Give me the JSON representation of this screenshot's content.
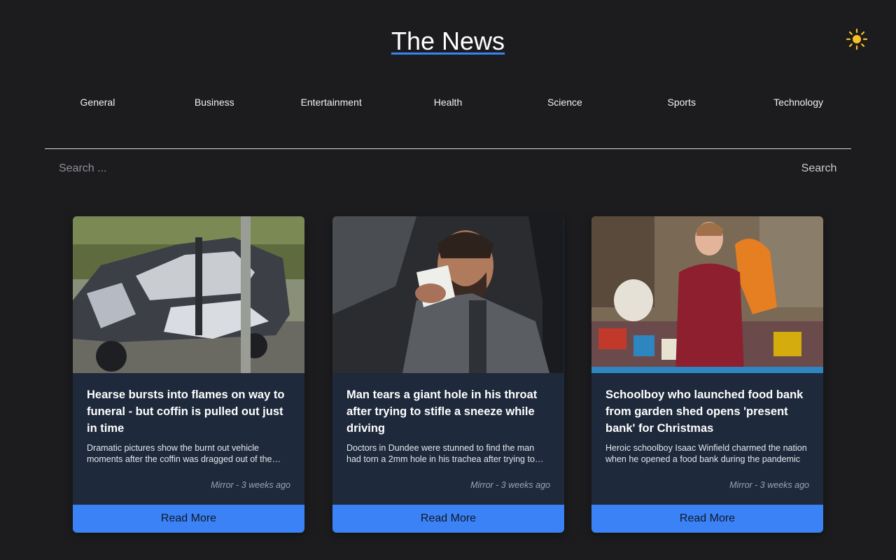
{
  "header": {
    "title": "The News",
    "theme_toggle_icon": "sun-icon",
    "accent_color": "#3b82f6",
    "sun_color": "#fbbf24"
  },
  "nav": {
    "categories": [
      "General",
      "Business",
      "Entertainment",
      "Health",
      "Science",
      "Sports",
      "Technology"
    ]
  },
  "search": {
    "placeholder": "Search ...",
    "button_label": "Search"
  },
  "articles": [
    {
      "title": "Hearse bursts into flames on way to funeral - but coffin is pulled out just in time",
      "description": "Dramatic pictures show the burnt out vehicle moments after the coffin was dragged out of the hearse",
      "source": "Mirror",
      "time": "3 weeks ago",
      "meta": "Mirror - 3 weeks ago",
      "read_more": "Read More",
      "image_icon": "burnt-car-photo"
    },
    {
      "title": "Man tears a giant hole in his throat after trying to stifle a sneeze while driving",
      "description": "Doctors in Dundee were stunned to find the man had torn a 2mm hole in his trachea after trying to hold in a sneeze",
      "source": "Mirror",
      "time": "3 weeks ago",
      "meta": "Mirror - 3 weeks ago",
      "read_more": "Read More",
      "image_icon": "sneezing-driver-photo"
    },
    {
      "title": "Schoolboy who launched food bank from garden shed opens 'present bank' for Christmas",
      "description": "Heroic schoolboy Isaac Winfield charmed the nation when he opened a food bank during the pandemic",
      "source": "Mirror",
      "time": "3 weeks ago",
      "meta": "Mirror - 3 weeks ago",
      "read_more": "Read More",
      "image_icon": "schoolboy-present-bank-photo"
    }
  ]
}
